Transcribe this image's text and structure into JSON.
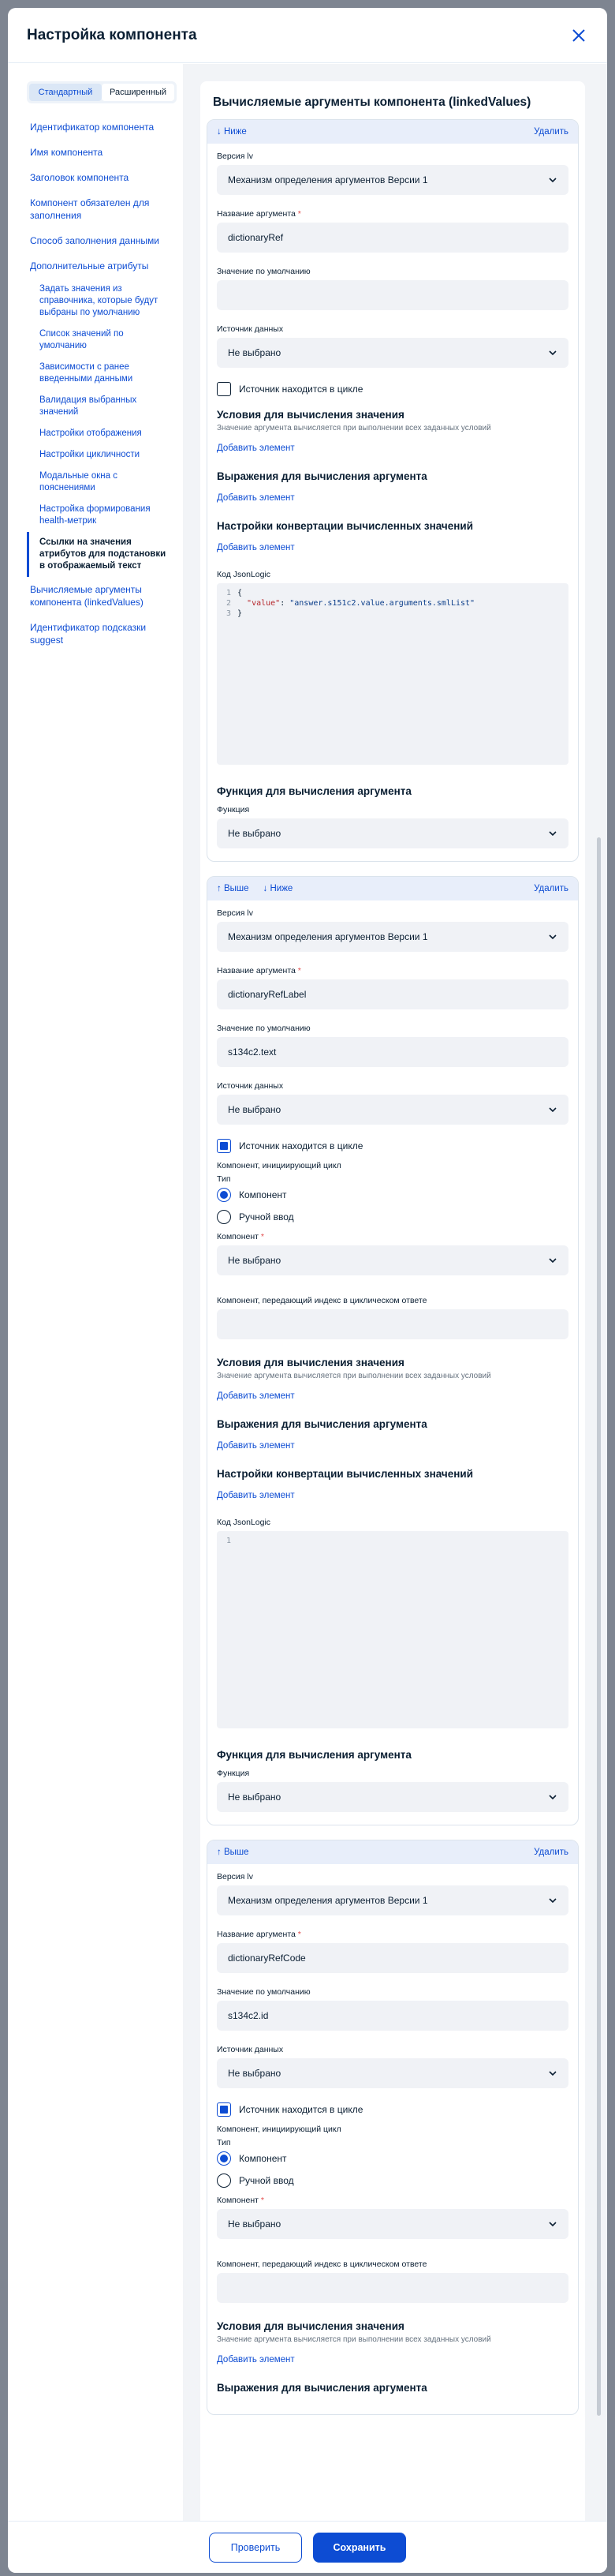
{
  "modal": {
    "title": "Настройка компонента"
  },
  "tabs": [
    "Стандартный",
    "Расширенный"
  ],
  "nav": [
    "Идентификатор компонента",
    "Имя компонента",
    "Заголовок компонента",
    "Компонент обязателен для заполнения",
    "Способ заполнения данными",
    "Дополнительные атрибуты"
  ],
  "nav_sub": [
    "Задать значения из справочника, которые будут выбраны по умолчанию",
    "Список значений по умолчанию",
    "Зависимости с ранее введенными данными",
    "Валидация выбранных значений",
    "Настройки отображения",
    "Настройки цикличности",
    "Модальные окна с пояснениями",
    "Настройка формирования health-метрик",
    "Ссылки на значения атрибутов для подстановки в отображаемый текст"
  ],
  "nav_after": [
    "Вычисляемые аргументы компонента (linkedValues)",
    "Идентификатор подсказки suggest"
  ],
  "section_title": "Вычисляемые аргументы компонента (linkedValues)",
  "labels": {
    "up": "Выше",
    "down": "Ниже",
    "delete": "Удалить",
    "version": "Версия lv",
    "arg_name": "Название аргумента",
    "default": "Значение по умолчанию",
    "source": "Источник данных",
    "in_cycle": "Источник находится в цикле",
    "conditions": "Условия для вычисления значения",
    "conditions_hint": "Значение аргумента вычисляется при выполнении всех заданных условий",
    "add": "Добавить элемент",
    "expressions": "Выражения для вычисления аргумента",
    "conversions": "Настройки конвертации вычисленных значений",
    "jsonlogic": "Код JsonLogic",
    "function_title": "Функция для вычисления аргумента",
    "function": "Функция",
    "cycle_component": "Компонент, инициирующий цикл",
    "type": "Тип",
    "component_radio": "Компонент",
    "manual_radio": "Ручной ввод",
    "component": "Компонент",
    "index_component": "Компонент, передающий индекс в циклическом ответе"
  },
  "cards": [
    {
      "version": "Механизм определения аргументов Версии 1",
      "arg_name": "dictionaryRef",
      "default": "",
      "source": "Не выбрано",
      "in_cycle": false,
      "code": [
        "{",
        "  \"value\": \"answer.s151c2.value.arguments.smlList\"",
        "}"
      ],
      "function": "Не выбрано"
    },
    {
      "version": "Механизм определения аргументов Версии 1",
      "arg_name": "dictionaryRefLabel",
      "default": "s134c2.text",
      "source": "Не выбрано",
      "in_cycle": true,
      "component": "Не выбрано",
      "code": [
        ""
      ],
      "function": "Не выбрано"
    },
    {
      "version": "Механизм определения аргументов Версии 1",
      "arg_name": "dictionaryRefCode",
      "default": "s134c2.id",
      "source": "Не выбрано",
      "in_cycle": true,
      "component": "Не выбрано"
    }
  ],
  "footer": {
    "check": "Проверить",
    "save": "Сохранить"
  },
  "colors": {
    "accent": "#0d4cd3",
    "card_head": "#e8eefa",
    "field": "#f0f2f6"
  }
}
